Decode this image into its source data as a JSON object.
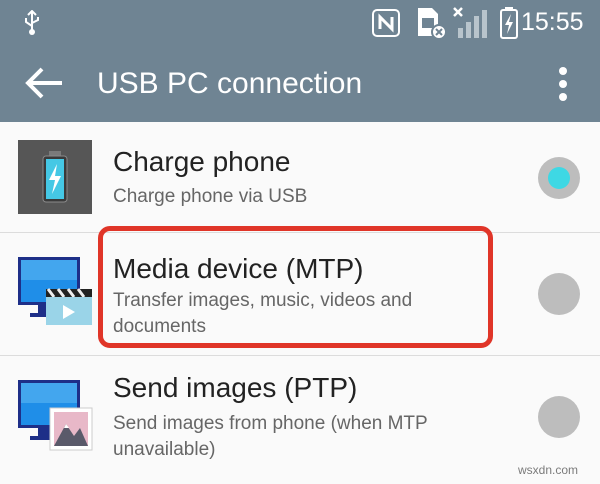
{
  "status_bar": {
    "time": "15:55",
    "icons": [
      "usb-icon",
      "nfc-icon",
      "sim-card-icon",
      "signal-icon",
      "battery-charging-icon"
    ]
  },
  "app_bar": {
    "title": "USB PC connection",
    "back_icon": "arrow-left-icon",
    "more_icon": "more-vert-icon"
  },
  "options": [
    {
      "title": "Charge phone",
      "subtitle": "Charge phone via USB",
      "icon": "battery-charge-icon",
      "selected": true
    },
    {
      "title": "Media device (MTP)",
      "subtitle": "Transfer images, music, videos and documents",
      "icon": "media-device-icon",
      "selected": false,
      "highlighted": true
    },
    {
      "title": "Send images (PTP)",
      "subtitle": "Send images from phone (when MTP unavailable)",
      "icon": "send-images-icon",
      "selected": false
    }
  ],
  "watermark": "wsxdn.com",
  "colors": {
    "bar": "#6f8493",
    "radio_selected": "#3ed8e4",
    "radio_unselected": "#bdbdbd",
    "highlight_border": "#e03528"
  }
}
